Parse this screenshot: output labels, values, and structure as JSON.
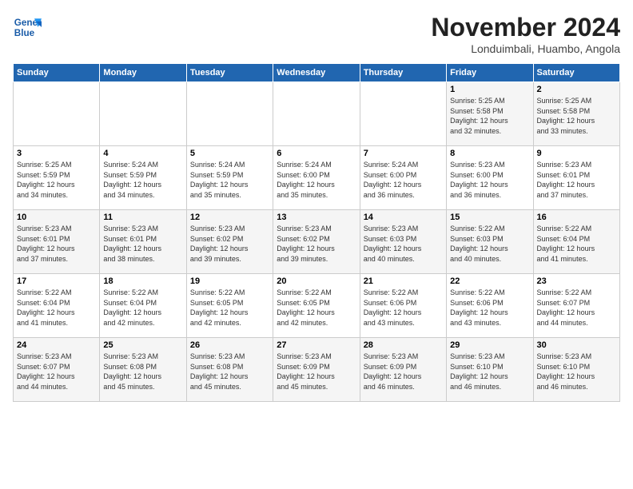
{
  "logo": {
    "name": "General",
    "name2": "Blue"
  },
  "header": {
    "month_year": "November 2024",
    "location": "Londuimbali, Huambo, Angola"
  },
  "weekdays": [
    "Sunday",
    "Monday",
    "Tuesday",
    "Wednesday",
    "Thursday",
    "Friday",
    "Saturday"
  ],
  "weeks": [
    [
      {
        "day": "",
        "info": ""
      },
      {
        "day": "",
        "info": ""
      },
      {
        "day": "",
        "info": ""
      },
      {
        "day": "",
        "info": ""
      },
      {
        "day": "",
        "info": ""
      },
      {
        "day": "1",
        "info": "Sunrise: 5:25 AM\nSunset: 5:58 PM\nDaylight: 12 hours\nand 32 minutes."
      },
      {
        "day": "2",
        "info": "Sunrise: 5:25 AM\nSunset: 5:58 PM\nDaylight: 12 hours\nand 33 minutes."
      }
    ],
    [
      {
        "day": "3",
        "info": "Sunrise: 5:25 AM\nSunset: 5:59 PM\nDaylight: 12 hours\nand 34 minutes."
      },
      {
        "day": "4",
        "info": "Sunrise: 5:24 AM\nSunset: 5:59 PM\nDaylight: 12 hours\nand 34 minutes."
      },
      {
        "day": "5",
        "info": "Sunrise: 5:24 AM\nSunset: 5:59 PM\nDaylight: 12 hours\nand 35 minutes."
      },
      {
        "day": "6",
        "info": "Sunrise: 5:24 AM\nSunset: 6:00 PM\nDaylight: 12 hours\nand 35 minutes."
      },
      {
        "day": "7",
        "info": "Sunrise: 5:24 AM\nSunset: 6:00 PM\nDaylight: 12 hours\nand 36 minutes."
      },
      {
        "day": "8",
        "info": "Sunrise: 5:23 AM\nSunset: 6:00 PM\nDaylight: 12 hours\nand 36 minutes."
      },
      {
        "day": "9",
        "info": "Sunrise: 5:23 AM\nSunset: 6:01 PM\nDaylight: 12 hours\nand 37 minutes."
      }
    ],
    [
      {
        "day": "10",
        "info": "Sunrise: 5:23 AM\nSunset: 6:01 PM\nDaylight: 12 hours\nand 37 minutes."
      },
      {
        "day": "11",
        "info": "Sunrise: 5:23 AM\nSunset: 6:01 PM\nDaylight: 12 hours\nand 38 minutes."
      },
      {
        "day": "12",
        "info": "Sunrise: 5:23 AM\nSunset: 6:02 PM\nDaylight: 12 hours\nand 39 minutes."
      },
      {
        "day": "13",
        "info": "Sunrise: 5:23 AM\nSunset: 6:02 PM\nDaylight: 12 hours\nand 39 minutes."
      },
      {
        "day": "14",
        "info": "Sunrise: 5:23 AM\nSunset: 6:03 PM\nDaylight: 12 hours\nand 40 minutes."
      },
      {
        "day": "15",
        "info": "Sunrise: 5:22 AM\nSunset: 6:03 PM\nDaylight: 12 hours\nand 40 minutes."
      },
      {
        "day": "16",
        "info": "Sunrise: 5:22 AM\nSunset: 6:04 PM\nDaylight: 12 hours\nand 41 minutes."
      }
    ],
    [
      {
        "day": "17",
        "info": "Sunrise: 5:22 AM\nSunset: 6:04 PM\nDaylight: 12 hours\nand 41 minutes."
      },
      {
        "day": "18",
        "info": "Sunrise: 5:22 AM\nSunset: 6:04 PM\nDaylight: 12 hours\nand 42 minutes."
      },
      {
        "day": "19",
        "info": "Sunrise: 5:22 AM\nSunset: 6:05 PM\nDaylight: 12 hours\nand 42 minutes."
      },
      {
        "day": "20",
        "info": "Sunrise: 5:22 AM\nSunset: 6:05 PM\nDaylight: 12 hours\nand 42 minutes."
      },
      {
        "day": "21",
        "info": "Sunrise: 5:22 AM\nSunset: 6:06 PM\nDaylight: 12 hours\nand 43 minutes."
      },
      {
        "day": "22",
        "info": "Sunrise: 5:22 AM\nSunset: 6:06 PM\nDaylight: 12 hours\nand 43 minutes."
      },
      {
        "day": "23",
        "info": "Sunrise: 5:22 AM\nSunset: 6:07 PM\nDaylight: 12 hours\nand 44 minutes."
      }
    ],
    [
      {
        "day": "24",
        "info": "Sunrise: 5:23 AM\nSunset: 6:07 PM\nDaylight: 12 hours\nand 44 minutes."
      },
      {
        "day": "25",
        "info": "Sunrise: 5:23 AM\nSunset: 6:08 PM\nDaylight: 12 hours\nand 45 minutes."
      },
      {
        "day": "26",
        "info": "Sunrise: 5:23 AM\nSunset: 6:08 PM\nDaylight: 12 hours\nand 45 minutes."
      },
      {
        "day": "27",
        "info": "Sunrise: 5:23 AM\nSunset: 6:09 PM\nDaylight: 12 hours\nand 45 minutes."
      },
      {
        "day": "28",
        "info": "Sunrise: 5:23 AM\nSunset: 6:09 PM\nDaylight: 12 hours\nand 46 minutes."
      },
      {
        "day": "29",
        "info": "Sunrise: 5:23 AM\nSunset: 6:10 PM\nDaylight: 12 hours\nand 46 minutes."
      },
      {
        "day": "30",
        "info": "Sunrise: 5:23 AM\nSunset: 6:10 PM\nDaylight: 12 hours\nand 46 minutes."
      }
    ]
  ]
}
